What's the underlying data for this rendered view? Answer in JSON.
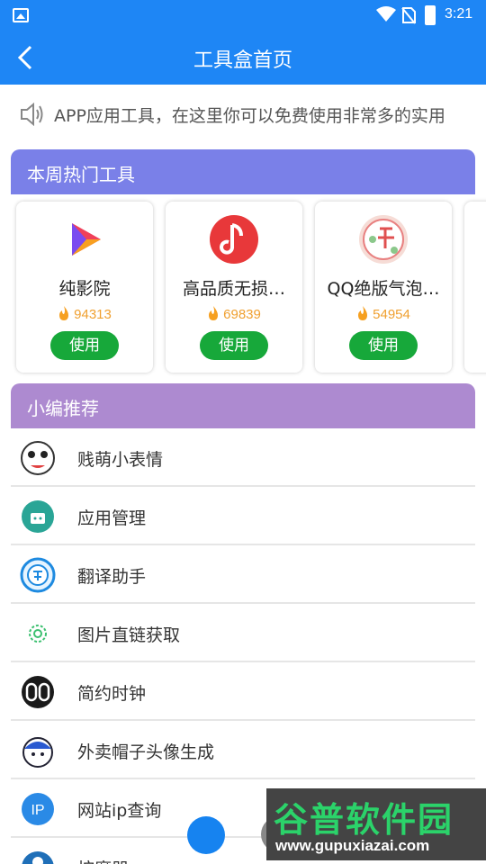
{
  "status_bar": {
    "time": "3:21"
  },
  "title_bar": {
    "title": "工具盒首页"
  },
  "notice": {
    "text": "APP应用工具，在这里你可以免费使用非常多的实用"
  },
  "hot_tools": {
    "header": "本周热门工具",
    "items": [
      {
        "name": "纯影院",
        "count": "94313",
        "button": "使用"
      },
      {
        "name": "高品质无损…",
        "count": "69839",
        "button": "使用"
      },
      {
        "name": "QQ绝版气泡…",
        "count": "54954",
        "button": "使用"
      }
    ]
  },
  "recommend": {
    "header": "小编推荐",
    "items": [
      {
        "label": "贱萌小表情"
      },
      {
        "label": "应用管理"
      },
      {
        "label": "翻译助手"
      },
      {
        "label": "图片直链获取"
      },
      {
        "label": "简约时钟"
      },
      {
        "label": "外卖帽子头像生成"
      },
      {
        "label": "网站ip查询"
      },
      {
        "label": "按摩器"
      }
    ]
  },
  "watermark": {
    "brand": "谷普软件园",
    "url": "www.gupuxiazai.com"
  },
  "colors": {
    "primary": "#1e86f5",
    "hot_header": "#7a80e8",
    "recommend_header": "#ad8ad0",
    "use_button": "#17a83a",
    "count": "#f0a030"
  }
}
